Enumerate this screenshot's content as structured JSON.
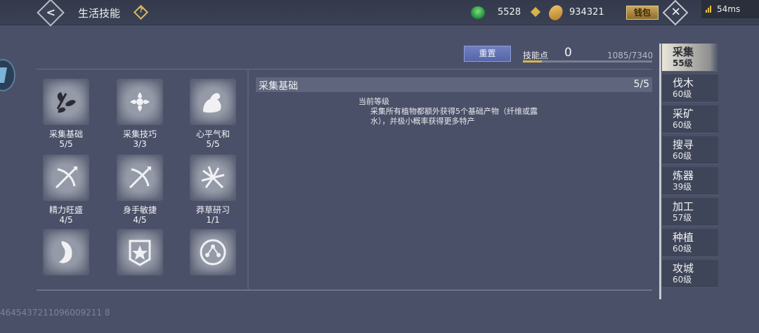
{
  "header": {
    "title": "生活技能",
    "help_glyph": "?",
    "back_glyph": "<",
    "close_glyph": "✕",
    "jade_amount": "5528",
    "coin_amount": "934321",
    "wallet_label": "钱包"
  },
  "status": {
    "ping": "54ms"
  },
  "points": {
    "reset_label": "重置",
    "label": "技能点",
    "value": "0",
    "exp_text": "1085/7340",
    "exp_fraction": 0.148
  },
  "skills": [
    {
      "name": "采集基础",
      "level": "5/5",
      "icon": "leaves-icon",
      "selected": true
    },
    {
      "name": "采集技巧",
      "level": "3/3",
      "icon": "flower-icon"
    },
    {
      "name": "心平气和",
      "level": "5/5",
      "icon": "arm-icon"
    },
    {
      "name": "精力旺盛",
      "level": "4/5",
      "icon": "bow-icon"
    },
    {
      "name": "身手敏捷",
      "level": "4/5",
      "icon": "bow-icon"
    },
    {
      "name": "莽草研习",
      "level": "1/1",
      "icon": "herb-icon"
    },
    {
      "name": "",
      "level": "",
      "icon": "pepper-icon"
    },
    {
      "name": "",
      "level": "",
      "icon": "banner-star-icon"
    },
    {
      "name": "",
      "level": "",
      "icon": "constellation-icon"
    }
  ],
  "detail": {
    "title": "采集基础",
    "level": "5/5",
    "current_level_label": "当前等级",
    "description": "采集所有植物都额外获得5个基础产物（纤维或露水），并极小概率获得更多特产"
  },
  "uid": "4645437211096009211 8",
  "tabs": [
    {
      "name": "采集",
      "level": "55级",
      "active": true
    },
    {
      "name": "伐木",
      "level": "60级"
    },
    {
      "name": "采矿",
      "level": "60级"
    },
    {
      "name": "搜寻",
      "level": "60级"
    },
    {
      "name": "炼器",
      "level": "39级"
    },
    {
      "name": "加工",
      "level": "57级"
    },
    {
      "name": "种植",
      "level": "60级"
    },
    {
      "name": "攻城",
      "level": "60级"
    }
  ],
  "colors": {
    "background": "#4a5068",
    "accent_gold": "#d8b64a",
    "reset_button": "#6f7fc0"
  }
}
